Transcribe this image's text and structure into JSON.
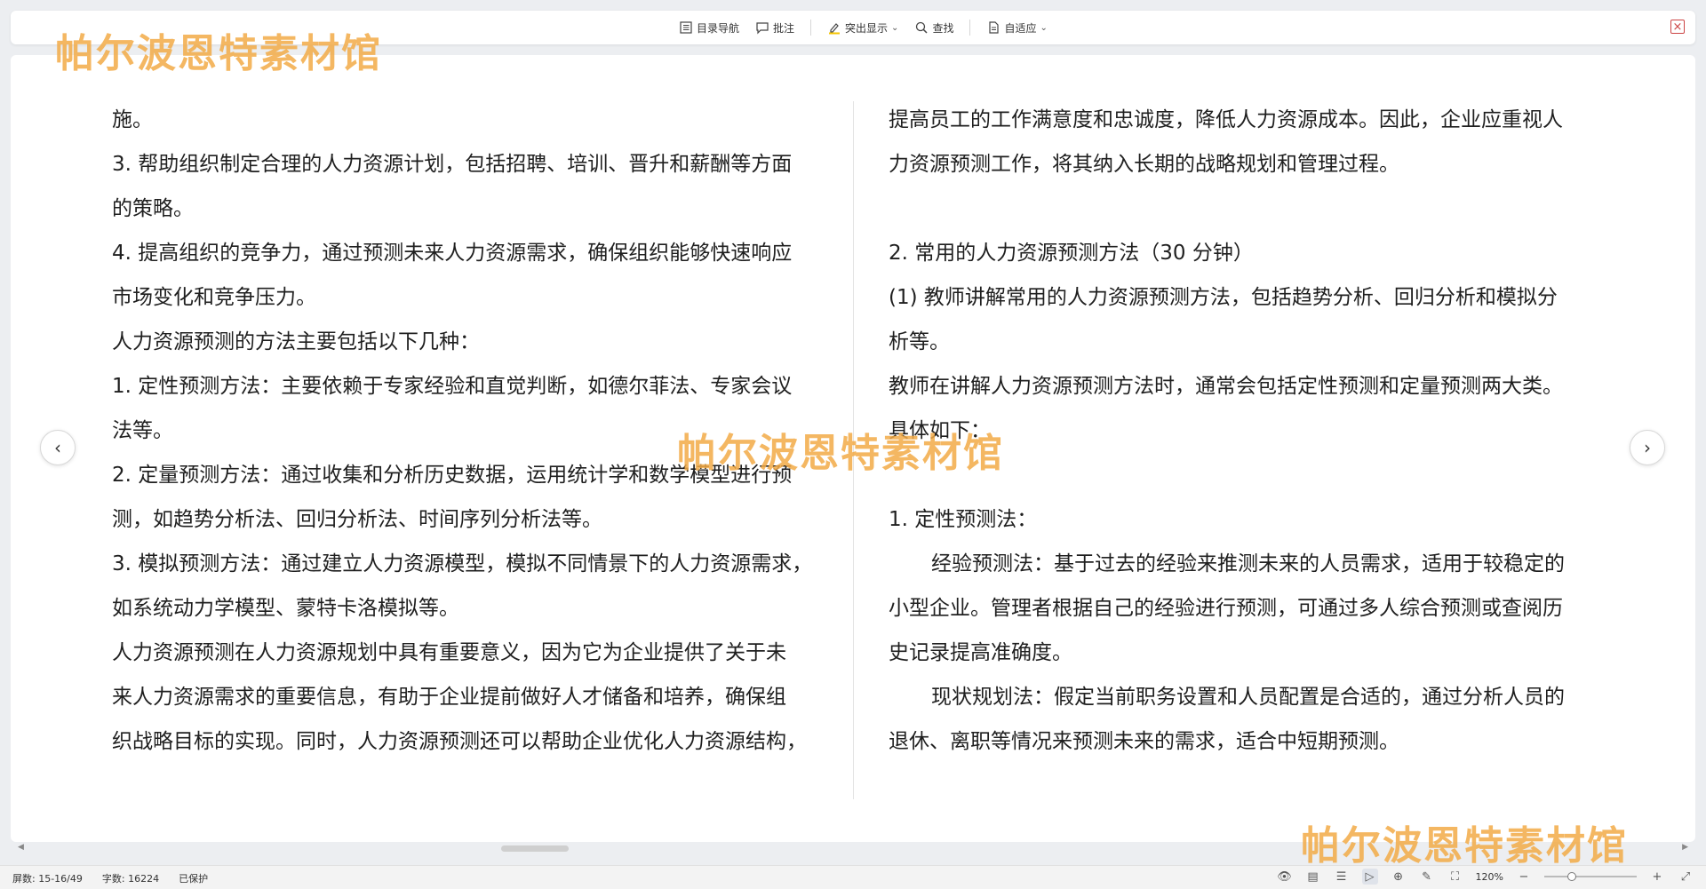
{
  "toolbar": {
    "items": [
      {
        "label": "目录导航",
        "icon": "outline-icon"
      },
      {
        "label": "批注",
        "icon": "comment-icon"
      },
      {
        "label": "突出显示",
        "icon": "highlight-icon"
      },
      {
        "label": "查找",
        "icon": "search-icon"
      },
      {
        "label": "自适应",
        "icon": "page-fit-icon"
      }
    ],
    "close_icon": "close-icon"
  },
  "document": {
    "left_paragraphs": [
      "施。",
      "3. 帮助组织制定合理的人力资源计划，包括招聘、培训、晋升和薪酬等方面",
      "的策略。",
      "4. 提高组织的竞争力，通过预测未来人力资源需求，确保组织能够快速响应",
      "市场变化和竞争压力。",
      "人力资源预测的方法主要包括以下几种：",
      "1. 定性预测方法：主要依赖于专家经验和直觉判断，如德尔菲法、专家会议",
      "法等。",
      "2. 定量预测方法：通过收集和分析历史数据，运用统计学和数学模型进行预",
      "测，如趋势分析法、回归分析法、时间序列分析法等。",
      "3. 模拟预测方法：通过建立人力资源模型，模拟不同情景下的人力资源需求，",
      "如系统动力学模型、蒙特卡洛模拟等。",
      "人力资源预测在人力资源规划中具有重要意义，因为它为企业提供了关于未",
      "来人力资源需求的重要信息，有助于企业提前做好人才储备和培养，确保组",
      "织战略目标的实现。同时，人力资源预测还可以帮助企业优化人力资源结构，"
    ],
    "right_paragraphs": [
      "提高员工的工作满意度和忠诚度，降低人力资源成本。因此，企业应重视人",
      "力资源预测工作，将其纳入长期的战略规划和管理过程。",
      "",
      "2. 常用的人力资源预测方法（30 分钟）",
      "(1) 教师讲解常用的人力资源预测方法，包括趋势分析、回归分析和模拟分",
      "析等。",
      "教师在讲解人力资源预测方法时，通常会包括定性预测和定量预测两大类。",
      "具体如下：",
      "",
      "1. 定性预测法：",
      "经验预测法：基于过去的经验来推测未来的人员需求，适用于较稳定的",
      "小型企业。管理者根据自己的经验进行预测，可通过多人综合预测或查阅历",
      "史记录提高准确度。",
      "现状规划法：假定当前职务设置和人员配置是合适的，通过分析人员的",
      "退休、离职等情况来预测未来的需求，适合中短期预测。"
    ]
  },
  "watermark": {
    "text": "帕尔波恩特素材馆"
  },
  "status": {
    "pages": "屏数: 15-16/49",
    "words": "字数: 16224",
    "protect": "已保护",
    "zoom_label": "120%",
    "zoom_fraction": 0.3
  }
}
